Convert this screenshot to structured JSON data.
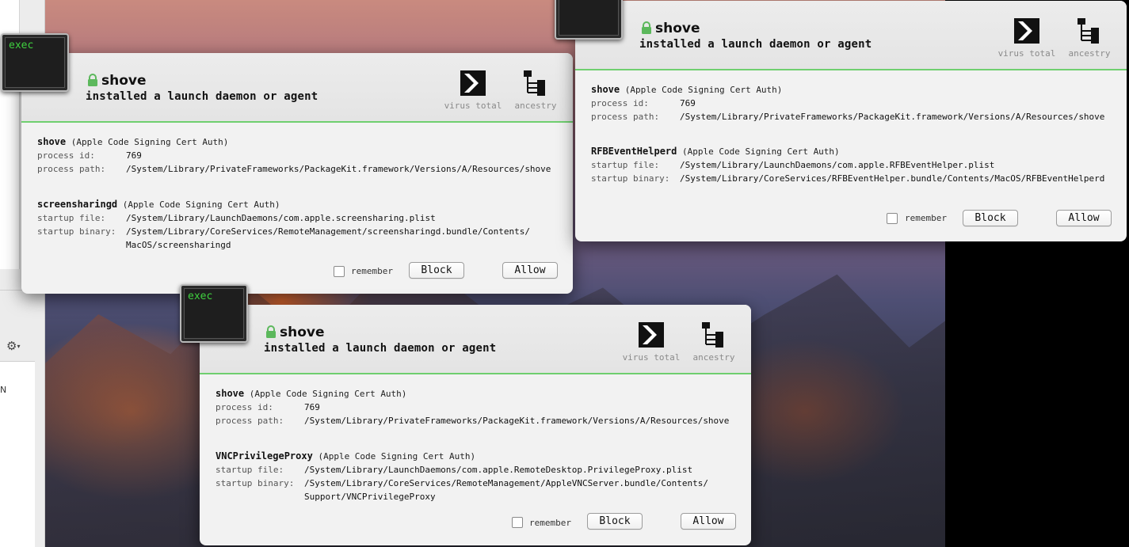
{
  "sidebar": {
    "extra_char": "N"
  },
  "exec_label": "exec",
  "header_buttons": {
    "virus_total": "virus total",
    "ancestry": "ancestry"
  },
  "alerts": [
    {
      "process_name": "shove",
      "headline": "installed a launch daemon or agent",
      "process": {
        "name": "shove",
        "signer": "(Apple Code Signing Cert Auth)",
        "id_label": "process id:",
        "id": "769",
        "path_label": "process path:",
        "path": "/System/Library/PrivateFrameworks/PackageKit.framework/Versions/A/Resources/shove"
      },
      "item": {
        "name": "screensharingd",
        "signer": "(Apple Code Signing Cert Auth)",
        "file_label": "startup file:",
        "file": "/System/Library/LaunchDaemons/com.apple.screensharing.plist",
        "binary_label": "startup binary:",
        "binary": "/System/Library/CoreServices/RemoteManagement/screensharingd.bundle/Contents/",
        "binary_cont": "MacOS/screensharingd"
      },
      "remember_label": "remember",
      "block_label": "Block",
      "allow_label": "Allow"
    },
    {
      "process_name": "shove",
      "headline": "installed a launch daemon or agent",
      "process": {
        "name": "shove",
        "signer": "(Apple Code Signing Cert Auth)",
        "id_label": "process id:",
        "id": "769",
        "path_label": "process path:",
        "path": "/System/Library/PrivateFrameworks/PackageKit.framework/Versions/A/Resources/shove"
      },
      "item": {
        "name": "RFBEventHelperd",
        "signer": "(Apple Code Signing Cert Auth)",
        "file_label": "startup file:",
        "file": "/System/Library/LaunchDaemons/com.apple.RFBEventHelper.plist",
        "binary_label": "startup binary:",
        "binary": "/System/Library/CoreServices/RFBEventHelper.bundle/Contents/MacOS/RFBEventHelperd",
        "binary_cont": ""
      },
      "remember_label": "remember",
      "block_label": "Block",
      "allow_label": "Allow"
    },
    {
      "process_name": "shove",
      "headline": "installed a launch daemon or agent",
      "process": {
        "name": "shove",
        "signer": "(Apple Code Signing Cert Auth)",
        "id_label": "process id:",
        "id": "769",
        "path_label": "process path:",
        "path": "/System/Library/PrivateFrameworks/PackageKit.framework/Versions/A/Resources/shove"
      },
      "item": {
        "name": "VNCPrivilegeProxy",
        "signer": "(Apple Code Signing Cert Auth)",
        "file_label": "startup file:",
        "file": "/System/Library/LaunchDaemons/com.apple.RemoteDesktop.PrivilegeProxy.plist",
        "binary_label": "startup binary:",
        "binary": "/System/Library/CoreServices/RemoteManagement/AppleVNCServer.bundle/Contents/",
        "binary_cont": "Support/VNCPrivilegeProxy"
      },
      "remember_label": "remember",
      "block_label": "Block",
      "allow_label": "Allow"
    }
  ],
  "colors": {
    "accent_green": "#6fcf6f",
    "lock_green": "#5cb85c",
    "terminal_text": "#3fd13f"
  },
  "icons": {
    "lock": "lock-icon",
    "virus_total": "virus-total-icon",
    "ancestry": "ancestry-tree-icon",
    "gear": "gear-icon"
  }
}
